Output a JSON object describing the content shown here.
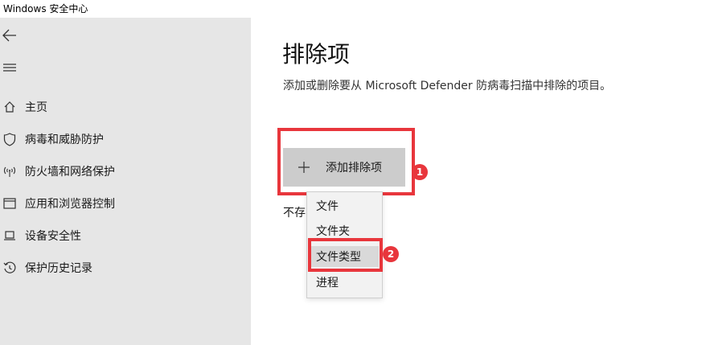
{
  "window": {
    "title": "Windows 安全中心"
  },
  "sidebar": {
    "back_icon": "back-arrow-icon",
    "menu_icon": "hamburger-menu-icon",
    "items": [
      {
        "label": "主页",
        "icon": "home-icon"
      },
      {
        "label": "病毒和威胁防护",
        "icon": "shield-icon"
      },
      {
        "label": "防火墙和网络保护",
        "icon": "wireless-signal-icon"
      },
      {
        "label": "应用和浏览器控制",
        "icon": "app-window-icon"
      },
      {
        "label": "设备安全性",
        "icon": "laptop-icon"
      },
      {
        "label": "保护历史记录",
        "icon": "history-icon"
      }
    ]
  },
  "main": {
    "title": "排除项",
    "description": "添加或删除要从 Microsoft Defender 防病毒扫描中排除的项目。",
    "add_button_label": "添加排除项",
    "add_button_icon": "plus-icon",
    "empty_text_visible": "不存"
  },
  "dropdown": {
    "items": [
      "文件",
      "文件夹",
      "文件类型",
      "进程"
    ],
    "selected_index": 2
  },
  "annotations": {
    "badge_1": "1",
    "badge_2": "2",
    "highlight_color": "#e8363c"
  }
}
